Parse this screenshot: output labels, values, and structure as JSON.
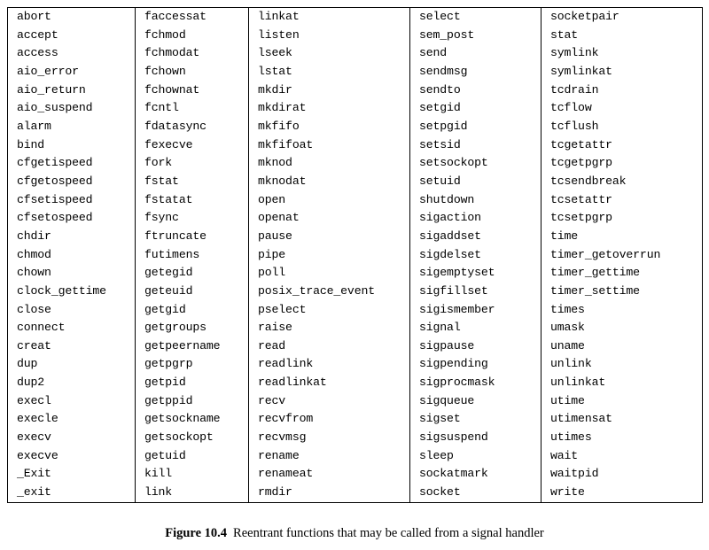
{
  "figure": {
    "label": "Figure 10.4",
    "caption": "Reentrant functions that may be called from a signal handler"
  },
  "table": {
    "rows": 28,
    "columns": 5,
    "cells": [
      [
        "abort",
        "faccessat",
        "linkat",
        "select",
        "socketpair"
      ],
      [
        "accept",
        "fchmod",
        "listen",
        "sem_post",
        "stat"
      ],
      [
        "access",
        "fchmodat",
        "lseek",
        "send",
        "symlink"
      ],
      [
        "aio_error",
        "fchown",
        "lstat",
        "sendmsg",
        "symlinkat"
      ],
      [
        "aio_return",
        "fchownat",
        "mkdir",
        "sendto",
        "tcdrain"
      ],
      [
        "aio_suspend",
        "fcntl",
        "mkdirat",
        "setgid",
        "tcflow"
      ],
      [
        "alarm",
        "fdatasync",
        "mkfifo",
        "setpgid",
        "tcflush"
      ],
      [
        "bind",
        "fexecve",
        "mkfifoat",
        "setsid",
        "tcgetattr"
      ],
      [
        "cfgetispeed",
        "fork",
        "mknod",
        "setsockopt",
        "tcgetpgrp"
      ],
      [
        "cfgetospeed",
        "fstat",
        "mknodat",
        "setuid",
        "tcsendbreak"
      ],
      [
        "cfsetispeed",
        "fstatat",
        "open",
        "shutdown",
        "tcsetattr"
      ],
      [
        "cfsetospeed",
        "fsync",
        "openat",
        "sigaction",
        "tcsetpgrp"
      ],
      [
        "chdir",
        "ftruncate",
        "pause",
        "sigaddset",
        "time"
      ],
      [
        "chmod",
        "futimens",
        "pipe",
        "sigdelset",
        "timer_getoverrun"
      ],
      [
        "chown",
        "getegid",
        "poll",
        "sigemptyset",
        "timer_gettime"
      ],
      [
        "clock_gettime",
        "geteuid",
        "posix_trace_event",
        "sigfillset",
        "timer_settime"
      ],
      [
        "close",
        "getgid",
        "pselect",
        "sigismember",
        "times"
      ],
      [
        "connect",
        "getgroups",
        "raise",
        "signal",
        "umask"
      ],
      [
        "creat",
        "getpeername",
        "read",
        "sigpause",
        "uname"
      ],
      [
        "dup",
        "getpgrp",
        "readlink",
        "sigpending",
        "unlink"
      ],
      [
        "dup2",
        "getpid",
        "readlinkat",
        "sigprocmask",
        "unlinkat"
      ],
      [
        "execl",
        "getppid",
        "recv",
        "sigqueue",
        "utime"
      ],
      [
        "execle",
        "getsockname",
        "recvfrom",
        "sigset",
        "utimensat"
      ],
      [
        "execv",
        "getsockopt",
        "recvmsg",
        "sigsuspend",
        "utimes"
      ],
      [
        "execve",
        "getuid",
        "rename",
        "sleep",
        "wait"
      ],
      [
        "_Exit",
        "kill",
        "renameat",
        "sockatmark",
        "waitpid"
      ],
      [
        "_exit",
        "link",
        "rmdir",
        "socket",
        "write"
      ]
    ]
  },
  "colors": {
    "text": "#000000",
    "background": "#ffffff",
    "rule": "#000000"
  }
}
